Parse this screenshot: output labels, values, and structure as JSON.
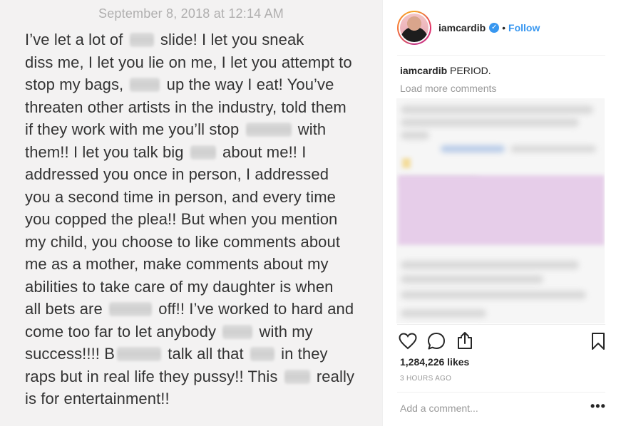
{
  "note": {
    "date": "September 8, 2018 at 12:14 AM",
    "lines": [
      [
        {
          "t": "I’ve let a lot of "
        },
        {
          "b": 34
        },
        {
          "t": " slide! I let you sneak"
        }
      ],
      [
        {
          "t": "diss me, I let you lie on me, I let you attempt to"
        }
      ],
      [
        {
          "t": "stop my bags, "
        },
        {
          "b": 42
        },
        {
          "t": " up the way I eat! You’ve"
        }
      ],
      [
        {
          "t": "threaten other artists in the industry, told them"
        }
      ],
      [
        {
          "t": "if they work with me you’ll stop "
        },
        {
          "b": 64
        },
        {
          "t": " with"
        }
      ],
      [
        {
          "t": "them!! I let you talk big "
        },
        {
          "b": 36
        },
        {
          "t": " about me!! I"
        }
      ],
      [
        {
          "t": "addressed you once in person, I addressed"
        }
      ],
      [
        {
          "t": "you a second time in person, and every time"
        }
      ],
      [
        {
          "t": "you copped the plea!! But when you mention"
        }
      ],
      [
        {
          "t": "my child, you choose to like comments about"
        }
      ],
      [
        {
          "t": "me as a mother, make comments about my"
        }
      ],
      [
        {
          "t": "abilities to take care of my daughter is when"
        }
      ],
      [
        {
          "t": "all bets are "
        },
        {
          "b": 60
        },
        {
          "t": " off!! I’ve worked to hard and"
        }
      ],
      [
        {
          "t": "come too far to let anybody "
        },
        {
          "b": 42
        },
        {
          "t": " with my"
        }
      ],
      [
        {
          "t": "success!!!! B"
        },
        {
          "b": 62
        },
        {
          "t": " talk all that "
        },
        {
          "b": 34
        },
        {
          "t": " in they"
        }
      ],
      [
        {
          "t": "raps but in real life they pussy!! This "
        },
        {
          "b": 36
        },
        {
          "t": " really"
        }
      ],
      [
        {
          "t": "is for entertainment!!"
        }
      ]
    ]
  },
  "post": {
    "username": "iamcardib",
    "verified_glyph": "✓",
    "separator": "•",
    "follow_label": "Follow",
    "caption_user": "iamcardib",
    "caption_text": "PERIOD.",
    "load_more": "Load more comments",
    "likes": "1,284,226 likes",
    "time_ago": "3 HOURS AGO",
    "add_comment_placeholder": "Add a comment...",
    "more_glyph": "•••"
  },
  "icons": {
    "like": "heart-icon",
    "comment": "comment-icon",
    "share": "share-icon",
    "save": "bookmark-icon"
  },
  "colors": {
    "accent": "#3897f0",
    "text": "#262626",
    "muted": "#999999"
  }
}
